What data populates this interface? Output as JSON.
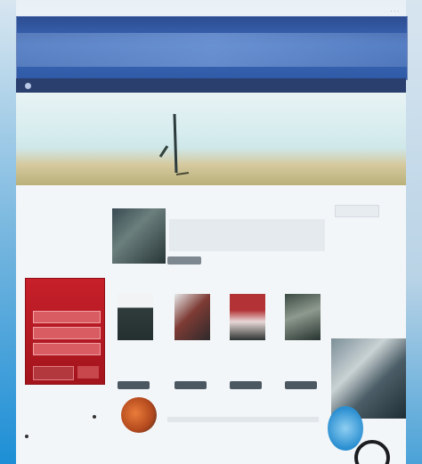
{
  "window": {
    "meta": "· · ·"
  },
  "header": {
    "logo": ""
  },
  "nav": {
    "items": [
      "",
      "",
      "",
      "",
      "",
      "",
      "",
      "",
      "",
      "",
      ""
    ]
  },
  "feature": {
    "title": "",
    "button": ""
  },
  "search": {
    "placeholder": ""
  },
  "promo": {
    "title": "",
    "subtitle": "",
    "button": ""
  },
  "cards": [
    {
      "caption": "",
      "button": ""
    },
    {
      "caption": "",
      "button": ""
    },
    {
      "caption": "",
      "button": ""
    },
    {
      "caption": "",
      "button": ""
    }
  ],
  "footer": {
    "text": ""
  },
  "colors": {
    "header": "#2f5aa6",
    "nav": "#2a3f6e",
    "promo": "#c7202a",
    "background": "#f3f6f8"
  }
}
